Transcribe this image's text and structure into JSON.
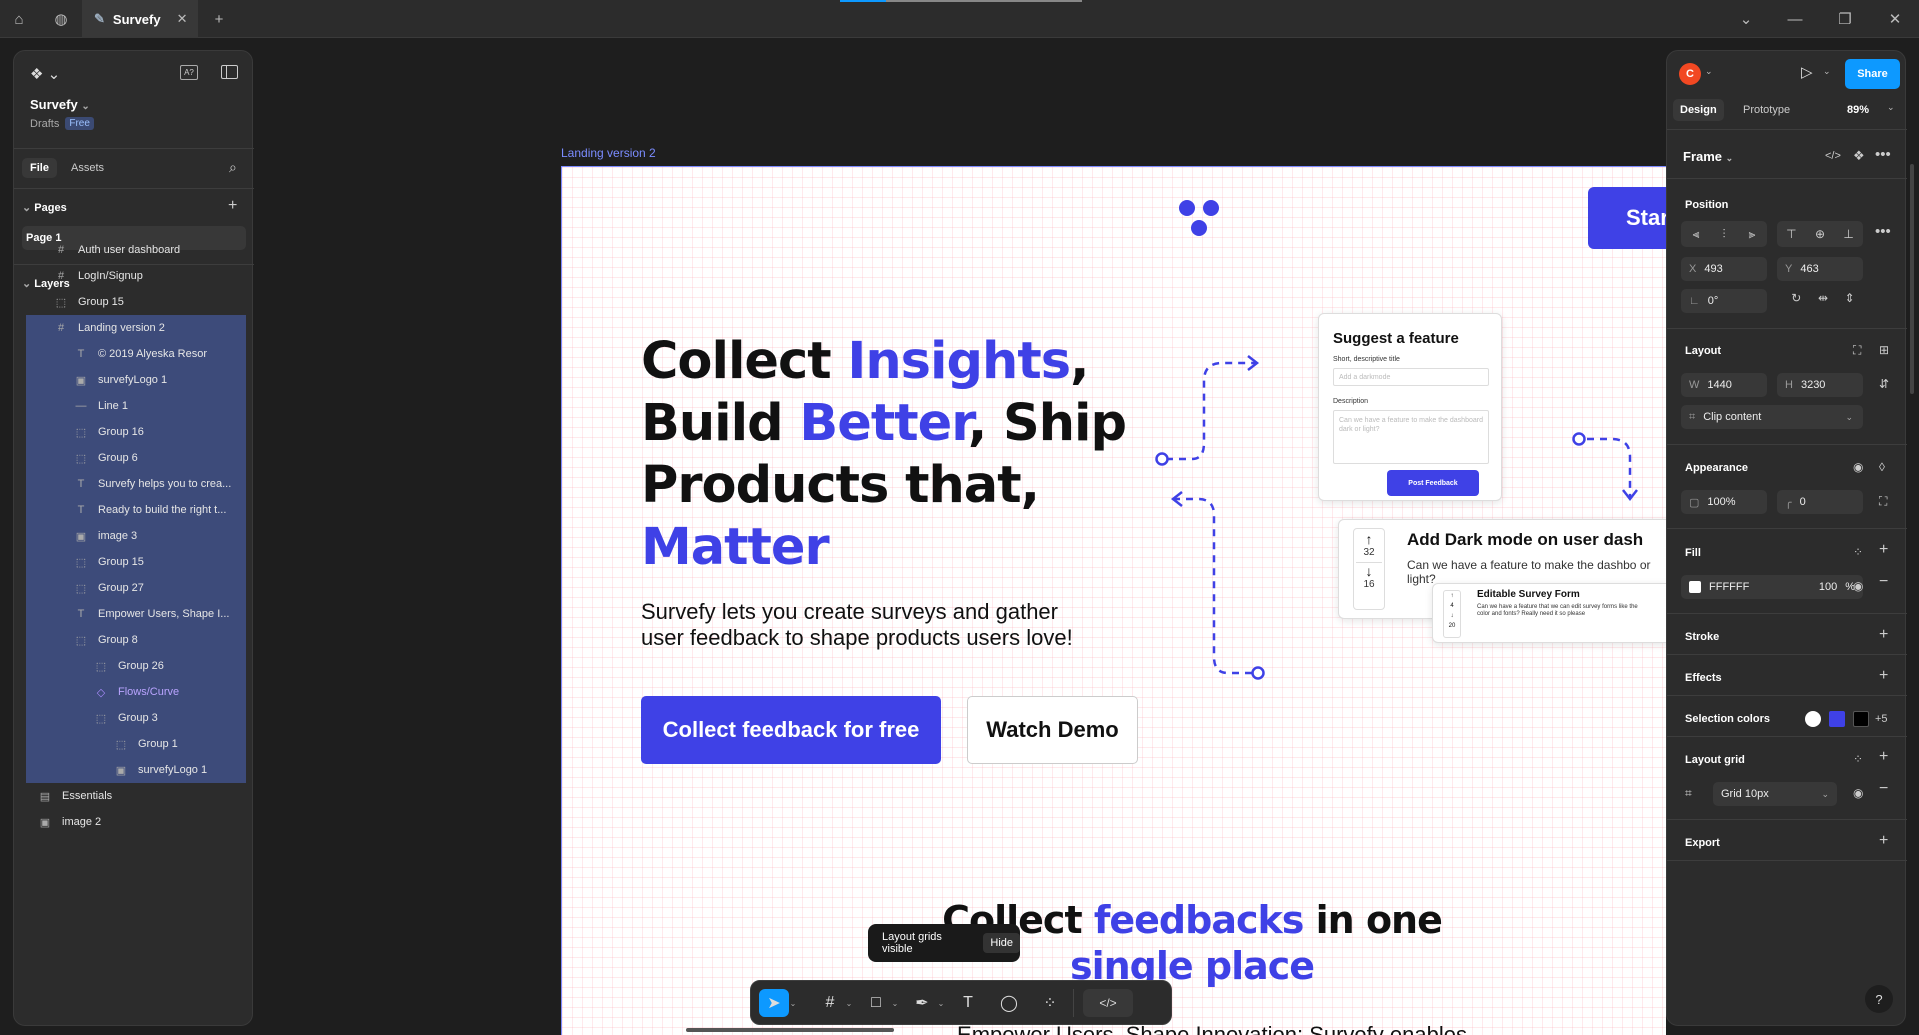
{
  "titlebar": {
    "tab_title": "Survefy",
    "plus": "+",
    "minimize": "—",
    "maximize": "❐",
    "close": "✕",
    "chevron": "⌄"
  },
  "left_panel": {
    "file_name": "Survefy",
    "drafts": "Drafts",
    "plan_badge": "Free",
    "tabs": [
      "File",
      "Assets"
    ],
    "pages_title": "Pages",
    "current_page": "Page 1",
    "layers_title": "Layers",
    "layers": [
      {
        "name": "Auth user dashboard",
        "icon": "#",
        "indent": 0,
        "selected": false
      },
      {
        "name": "LogIn/Signup",
        "icon": "#",
        "indent": 0,
        "selected": false
      },
      {
        "name": "Group 15",
        "icon": "⬚",
        "indent": 0,
        "selected": false
      },
      {
        "name": "Landing version 2",
        "icon": "#",
        "indent": 0,
        "selected": true
      },
      {
        "name": "© 2019 Alyeska Resor",
        "icon": "T",
        "indent": 1,
        "selected": true
      },
      {
        "name": "survefyLogo 1",
        "icon": "▣",
        "indent": 1,
        "selected": true
      },
      {
        "name": "Line 1",
        "icon": "—",
        "indent": 1,
        "selected": true
      },
      {
        "name": "Group 16",
        "icon": "⬚",
        "indent": 1,
        "selected": true
      },
      {
        "name": "Group 6",
        "icon": "⬚",
        "indent": 1,
        "selected": true
      },
      {
        "name": "Survefy helps you to crea...",
        "icon": "T",
        "indent": 1,
        "selected": true
      },
      {
        "name": "Ready to build the right t...",
        "icon": "T",
        "indent": 1,
        "selected": true
      },
      {
        "name": "image 3",
        "icon": "▣",
        "indent": 1,
        "selected": true
      },
      {
        "name": "Group 15",
        "icon": "⬚",
        "indent": 1,
        "selected": true
      },
      {
        "name": "Group 27",
        "icon": "⬚",
        "indent": 1,
        "selected": true
      },
      {
        "name": "Empower Users, Shape I...",
        "icon": "T",
        "indent": 1,
        "selected": true
      },
      {
        "name": "Group 8",
        "icon": "⬚",
        "indent": 1,
        "selected": true
      },
      {
        "name": "Group 26",
        "icon": "⬚",
        "indent": 2,
        "selected": true
      },
      {
        "name": "Flows/Curve",
        "icon": "◇",
        "indent": 2,
        "selected": true
      },
      {
        "name": "Group 3",
        "icon": "⬚",
        "indent": 2,
        "selected": true
      },
      {
        "name": "Group 1",
        "icon": "⬚",
        "indent": 3,
        "selected": true
      },
      {
        "name": "survefyLogo 1",
        "icon": "▣",
        "indent": 3,
        "selected": true
      },
      {
        "name": "Essentials",
        "icon": "▤",
        "indent": 0,
        "selected": false
      },
      {
        "name": "image 2",
        "icon": "▣",
        "indent": 0,
        "selected": false
      }
    ]
  },
  "right_panel": {
    "avatar_letter": "C",
    "share_label": "Share",
    "design_tab": "Design",
    "prototype_tab": "Prototype",
    "zoom": "89%",
    "frame_label": "Frame",
    "position_title": "Position",
    "x_label": "X",
    "x_value": "493",
    "y_label": "Y",
    "y_value": "463",
    "rotation": "0°",
    "layout_title": "Layout",
    "w_label": "W",
    "w_value": "1440",
    "h_label": "H",
    "h_value": "3230",
    "clip_content": "Clip content",
    "appearance_title": "Appearance",
    "opacity": "100%",
    "radius": "0",
    "fill_title": "Fill",
    "fill_hex": "FFFFFF",
    "fill_opacity": "100",
    "fill_pct": "%",
    "stroke_title": "Stroke",
    "effects_title": "Effects",
    "selection_colors_title": "Selection colors",
    "selection_more": "+5",
    "layout_grid_title": "Layout grid",
    "grid_value": "Grid 10px",
    "export_title": "Export",
    "help": "?",
    "colors": {
      "accent": "#0d99ff",
      "avatar": "#f24822",
      "selected_layer": "#3d4b7a",
      "brand_blue": "#3f41e6"
    }
  },
  "canvas": {
    "frame_name": "Landing version 2",
    "start_button": "Star",
    "hero_line1_a": "Collect ",
    "hero_line1_b": "Insights",
    "hero_line1_c": ",",
    "hero_line2_a": "Build ",
    "hero_line2_b": "Better",
    "hero_line2_c": ", Ship",
    "hero_line3": "Products that,",
    "hero_line4": "Matter",
    "hero_sub": "Survefy lets you create surveys and gather user feedback to shape products users love!",
    "cta_primary": "Collect feedback for free",
    "cta_secondary": "Watch Demo",
    "card1_title": "Suggest a feature",
    "card1_field1_label": "Short, descriptive title",
    "card1_field1_placeholder": "Add a darkmode",
    "card1_field2_label": "Description",
    "card1_field2_placeholder": "Can we have a feature to make the dashboard dark or light?",
    "card1_button": "Post Feedback",
    "card2_title": "Add Dark mode on user dash",
    "card2_body": "Can we have a feature to make the dashbo or light?",
    "card2_up": "32",
    "card2_down": "16",
    "card3_title": "Editable Survey Form",
    "card3_body": "Can we have a feature that we can edit survey forms like the color and fonts? Really need it so please",
    "card3_up": "4",
    "card3_down": "20",
    "section2_a": "Collect ",
    "section2_b": "feedbacks",
    "section2_c": " in one",
    "section2_d": "single place",
    "section2_sub": "Empower Users, Shape Innovation: Survefy enables"
  },
  "toast": {
    "text": "Layout grids visible",
    "hide": "Hide"
  }
}
